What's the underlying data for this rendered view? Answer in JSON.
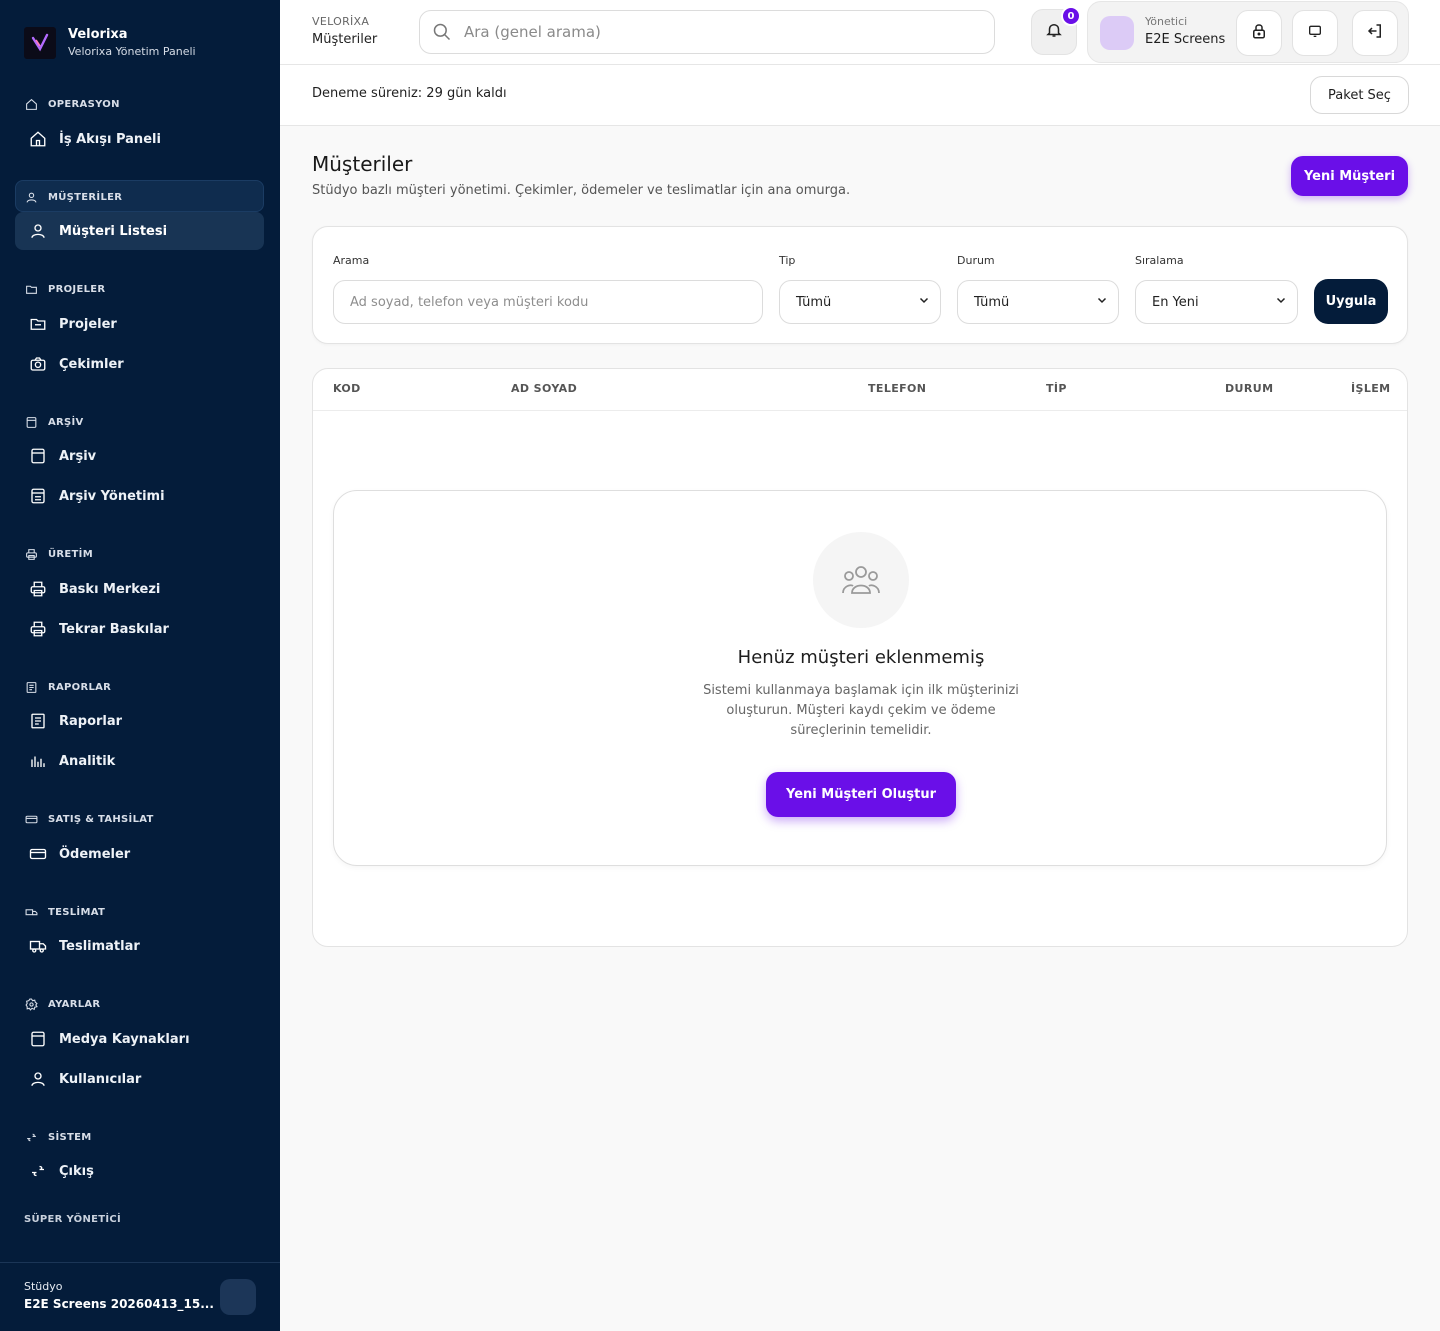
{
  "brand": {
    "name": "Velorixa",
    "subtitle": "Velorixa Yönetim Paneli",
    "logo_text": "VELORIXA"
  },
  "sidebar": {
    "sections": [
      {
        "label": "OPERASYON",
        "icon": "home-icon",
        "items": [
          {
            "label": "İş Akışı Paneli",
            "icon": "home-icon"
          }
        ]
      },
      {
        "label": "MÜŞTERİLER",
        "icon": "user-icon",
        "items": [
          {
            "label": "Müşteri Listesi",
            "icon": "user-icon",
            "active": true
          }
        ]
      },
      {
        "label": "PROJELER",
        "icon": "folder-icon",
        "items": [
          {
            "label": "Projeler",
            "icon": "folder-icon"
          },
          {
            "label": "Çekimler",
            "icon": "camera-icon"
          }
        ]
      },
      {
        "label": "ARŞİV",
        "icon": "archive-icon",
        "items": [
          {
            "label": "Arşiv",
            "icon": "archive-icon"
          },
          {
            "label": "Arşiv Yönetimi",
            "icon": "archive-manage-icon"
          }
        ]
      },
      {
        "label": "ÜRETİM",
        "icon": "printer-icon",
        "items": [
          {
            "label": "Baskı Merkezi",
            "icon": "printer-icon"
          },
          {
            "label": "Tekrar Baskılar",
            "icon": "printer-icon"
          }
        ]
      },
      {
        "label": "RAPORLAR",
        "icon": "report-icon",
        "items": [
          {
            "label": "Raporlar",
            "icon": "report-icon"
          },
          {
            "label": "Analitik",
            "icon": "analytics-icon"
          }
        ]
      },
      {
        "label": "SATIŞ & TAHSİLAT",
        "icon": "card-icon",
        "items": [
          {
            "label": "Ödemeler",
            "icon": "card-icon"
          }
        ]
      },
      {
        "label": "TESLİMAT",
        "icon": "truck-icon",
        "items": [
          {
            "label": "Teslimatlar",
            "icon": "truck-icon"
          }
        ]
      },
      {
        "label": "AYARLAR",
        "icon": "gear-icon",
        "items": [
          {
            "label": "Medya Kaynakları",
            "icon": "media-icon"
          },
          {
            "label": "Kullanıcılar",
            "icon": "user-icon"
          }
        ]
      },
      {
        "label": "SİSTEM",
        "icon": "link-icon",
        "items": [
          {
            "label": "Çıkış",
            "icon": "link-icon"
          }
        ]
      }
    ],
    "super_admin": "SÜPER YÖNETİCİ",
    "studio_label": "Stüdyo",
    "studio_name": "E2E Screens 20260413_15..."
  },
  "header": {
    "crumb_top": "VELORİXA",
    "crumb_main": "Müşteriler",
    "search_placeholder": "Ara (genel arama)",
    "notification_count": "0",
    "user_role": "Yönetici",
    "user_name": "E2E Screens"
  },
  "trial": {
    "text": "Deneme süreniz: 29 gün kaldı",
    "package_button": "Paket Seç"
  },
  "page": {
    "title": "Müşteriler",
    "subtitle": "Stüdyo bazlı müşteri yönetimi. Çekimler, ödemeler ve teslimatlar için ana omurga.",
    "new_button": "Yeni Müşteri"
  },
  "filters": {
    "search_label": "Arama",
    "search_placeholder": "Ad soyad, telefon veya müşteri kodu",
    "type_label": "Tip",
    "type_value": "Tümü",
    "status_label": "Durum",
    "status_value": "Tümü",
    "sort_label": "Sıralama",
    "sort_value": "En Yeni",
    "apply_button": "Uygula"
  },
  "table": {
    "columns": [
      "KOD",
      "AD SOYAD",
      "TELEFON",
      "TİP",
      "DURUM",
      "İŞLEM"
    ],
    "rows": [],
    "empty_title": "Henüz müşteri eklenmemiş",
    "empty_desc": "Sistemi kullanmaya başlamak için ilk müşterinizi oluşturun. Müşteri kaydı çekim ve ödeme süreçlerinin temelidir.",
    "empty_button": "Yeni Müşteri Oluştur"
  },
  "colors": {
    "sidebar_bg": "#041c3a",
    "accent": "#6a0fe8",
    "apply_bg": "#041c3a"
  }
}
